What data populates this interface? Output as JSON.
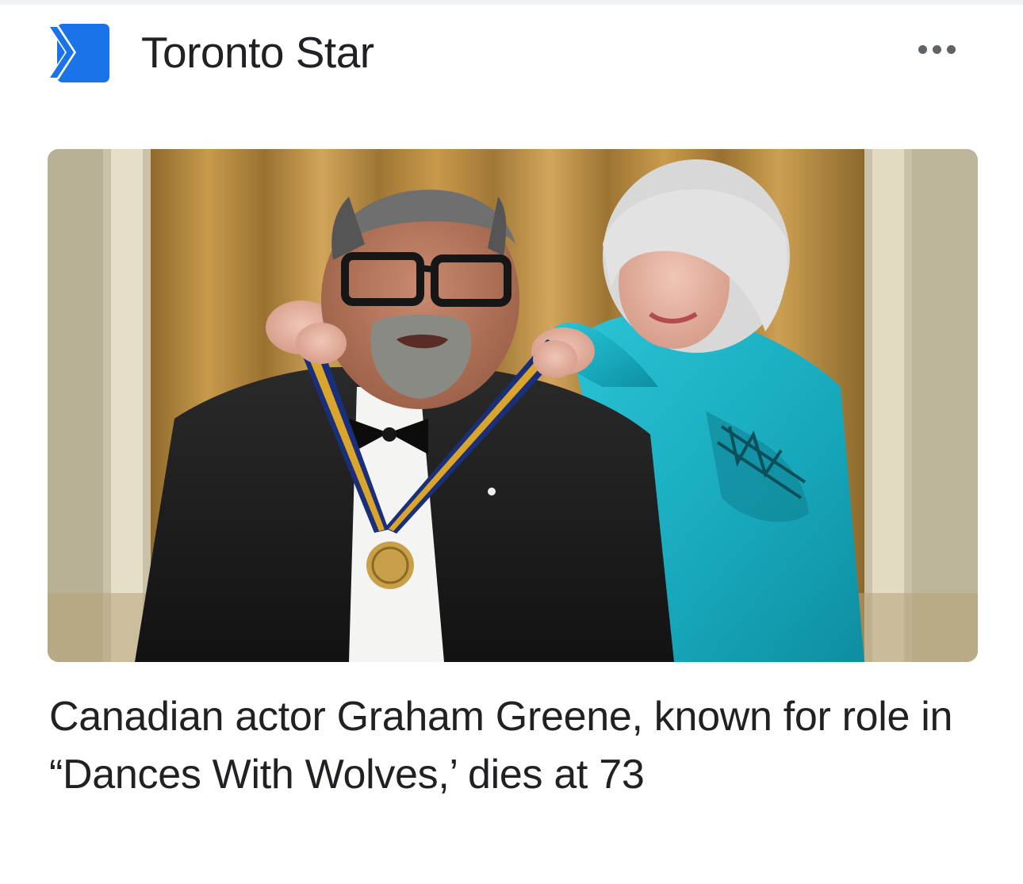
{
  "app": {
    "source": {
      "name": "Toronto Star",
      "logo_icon": "toronto-star-logo-icon",
      "logo_color": "#1a73e8"
    },
    "menu": {
      "icon": "more-horizontal-icon"
    }
  },
  "article": {
    "image_icon": "article-photo",
    "headline": "Canadian actor Graham Greene, known for role in “Dances With Wolves,’ dies at 73"
  },
  "colors": {
    "text": "#202124",
    "icon_gray": "#5f6368"
  }
}
